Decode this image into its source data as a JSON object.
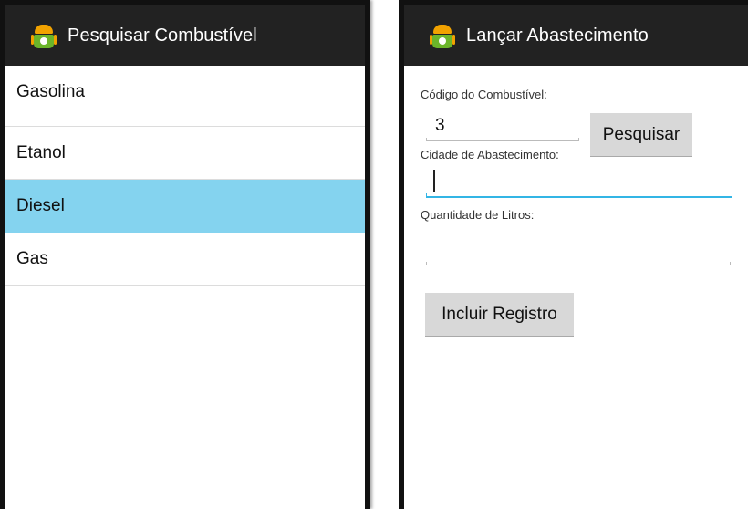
{
  "left_screen": {
    "title": "Pesquisar Combustível",
    "items": [
      {
        "label": "Gasolina",
        "selected": false
      },
      {
        "label": "Etanol",
        "selected": false
      },
      {
        "label": "Diesel",
        "selected": true
      },
      {
        "label": "Gas",
        "selected": false
      }
    ],
    "selected_color": "#84d3ef"
  },
  "right_screen": {
    "title": "Lançar Abastecimento",
    "codigo_label": "Código do Combustível:",
    "codigo_value": "3",
    "pesquisar_button": "Pesquisar",
    "cidade_label": "Cidade de Abastecimento:",
    "cidade_value": "",
    "quantidade_label": "Quantidade de Litros:",
    "quantidade_value": "",
    "incluir_button": "Incluir Registro",
    "focus_color": "#33b5e5"
  }
}
